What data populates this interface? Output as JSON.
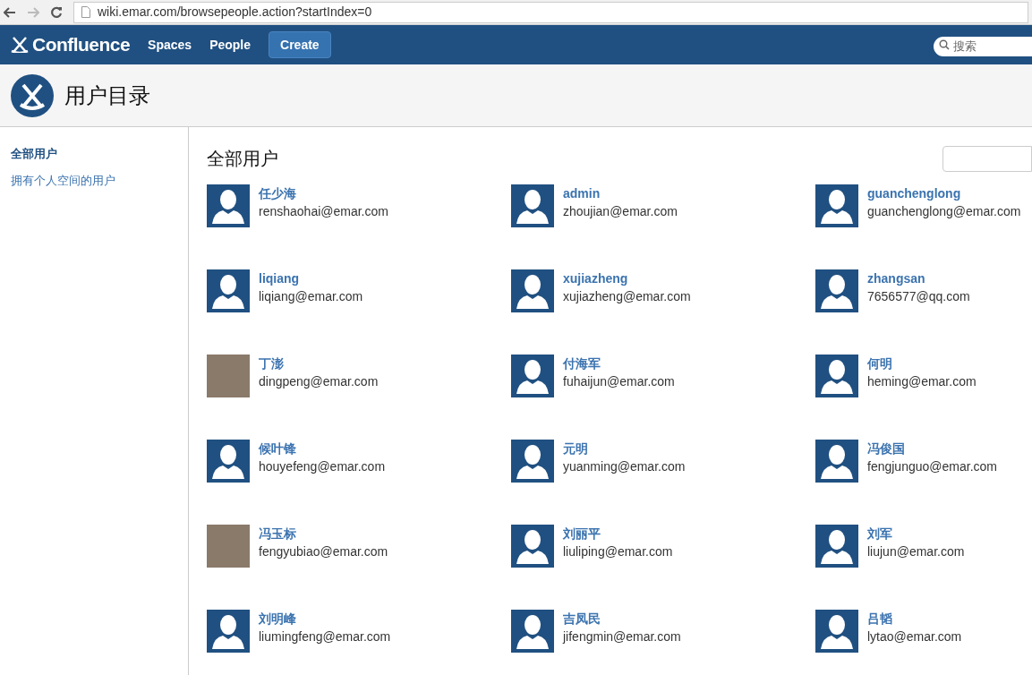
{
  "browser": {
    "url": "wiki.emar.com/browsepeople.action?startIndex=0"
  },
  "nav": {
    "logo": "Confluence",
    "links": [
      "Spaces",
      "People"
    ],
    "create": "Create",
    "search": {
      "placeholder": "搜索"
    }
  },
  "header": {
    "title": "用户目录"
  },
  "sidebar": {
    "items": [
      {
        "label": "全部用户",
        "selected": true
      },
      {
        "label": "拥有个人空间的用户",
        "selected": false
      }
    ]
  },
  "content": {
    "title": "全部用户",
    "users": [
      {
        "name": "任少海",
        "email": "renshaohai@emar.com",
        "kind": "default"
      },
      {
        "name": "admin",
        "email": "zhoujian@emar.com",
        "kind": "default"
      },
      {
        "name": "guanchenglong",
        "email": "guanchenglong@emar.com",
        "kind": "default"
      },
      {
        "name": "liqiang",
        "email": "liqiang@emar.com",
        "kind": "default"
      },
      {
        "name": "xujiazheng",
        "email": "xujiazheng@emar.com",
        "kind": "default"
      },
      {
        "name": "zhangsan",
        "email": "7656577@qq.com",
        "kind": "default"
      },
      {
        "name": "丁澎",
        "email": "dingpeng@emar.com",
        "kind": "photo"
      },
      {
        "name": "付海军",
        "email": "fuhaijun@emar.com",
        "kind": "default"
      },
      {
        "name": "何明",
        "email": "heming@emar.com",
        "kind": "default"
      },
      {
        "name": "候叶锋",
        "email": "houyefeng@emar.com",
        "kind": "default"
      },
      {
        "name": "元明",
        "email": "yuanming@emar.com",
        "kind": "default"
      },
      {
        "name": "冯俊国",
        "email": "fengjunguo@emar.com",
        "kind": "default"
      },
      {
        "name": "冯玉标",
        "email": "fengyubiao@emar.com",
        "kind": "photo"
      },
      {
        "name": "刘丽平",
        "email": "liuliping@emar.com",
        "kind": "default"
      },
      {
        "name": "刘军",
        "email": "liujun@emar.com",
        "kind": "default"
      },
      {
        "name": "刘明峰",
        "email": "liumingfeng@emar.com",
        "kind": "default"
      },
      {
        "name": "吉凤民",
        "email": "jifengmin@emar.com",
        "kind": "default"
      },
      {
        "name": "吕韬",
        "email": "lytao@emar.com",
        "kind": "default"
      }
    ]
  }
}
